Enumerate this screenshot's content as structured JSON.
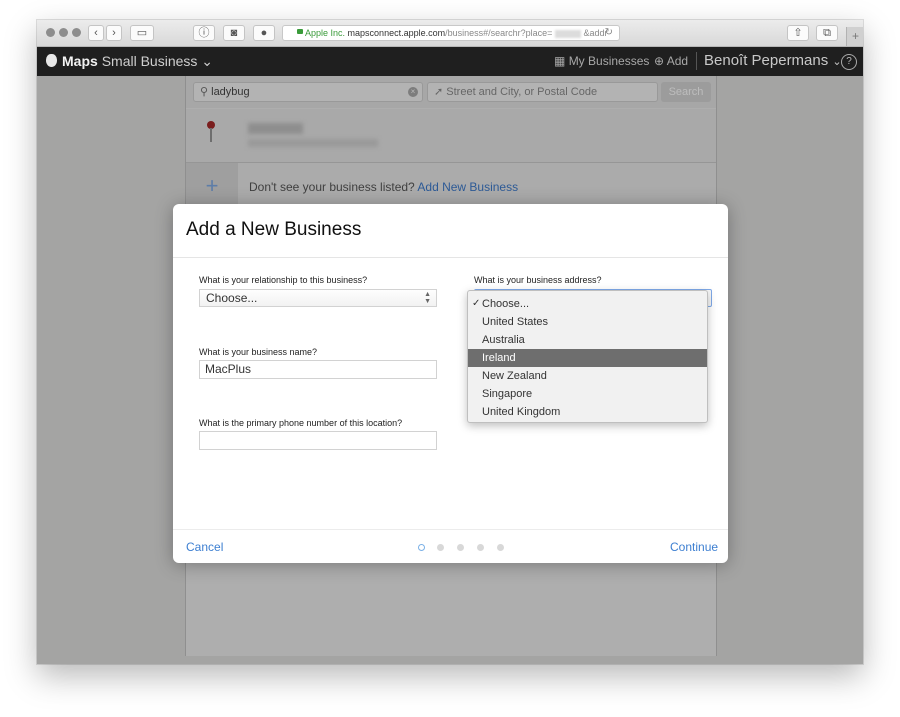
{
  "browser": {
    "url_company": "Apple Inc.",
    "url_host": "mapsconnect.apple.com",
    "url_path": "/business#/searchr?place=",
    "url_tail": "&addr"
  },
  "appbar": {
    "brand_bold": "Maps",
    "brand_light": "Small Business",
    "brand_caret": "⌄",
    "my_businesses": "My Businesses",
    "add": "Add",
    "user": "Benoît Pepermans",
    "user_caret": "⌄",
    "help": "?"
  },
  "search": {
    "query": "ladybug",
    "location_placeholder": "Street and City, or Postal Code",
    "button": "Search"
  },
  "not_listed": {
    "text": "Don't see your business listed?",
    "link": "Add New Business"
  },
  "modal": {
    "title": "Add a New Business",
    "relationship_label": "What is your relationship to this business?",
    "relationship_value": "Choose...",
    "name_label": "What is your business name?",
    "name_value": "MacPlus",
    "phone_label": "What is the primary phone number of this location?",
    "phone_value": "",
    "address_label": "What is your business address?",
    "address_options": [
      "Choose...",
      "United States",
      "Australia",
      "Ireland",
      "New Zealand",
      "Singapore",
      "United Kingdom"
    ],
    "address_checked": "Choose...",
    "address_highlighted": "Ireland",
    "cancel": "Cancel",
    "continue": "Continue",
    "steps_total": 5,
    "step_current": 1
  },
  "colors": {
    "accent": "#3d7fd1",
    "appbar": "#1f1f1f",
    "highlight": "#6e6e6e"
  }
}
